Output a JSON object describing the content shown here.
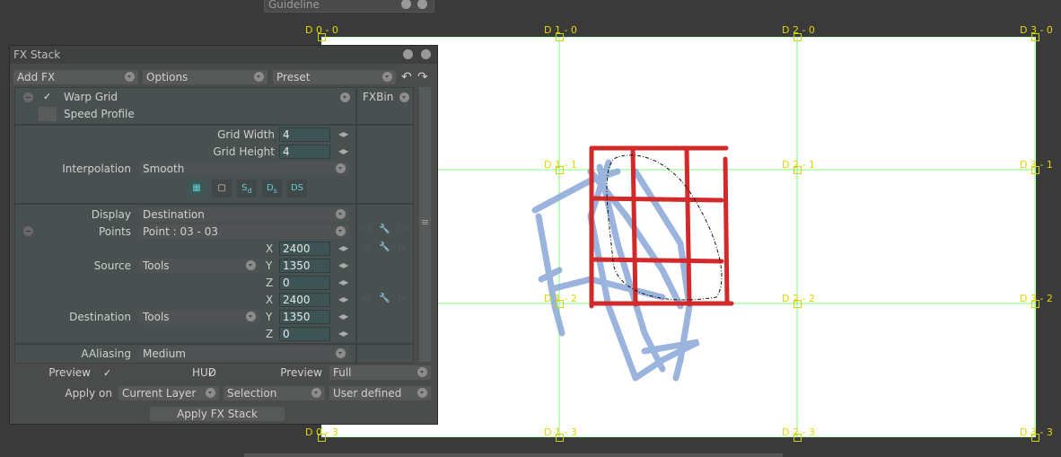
{
  "guideline_tab": {
    "title": "Guideline"
  },
  "canvas": {
    "grid_labels": {
      "row0": [
        "D 0 - 0",
        "D 1 - 0",
        "D 2 - 0",
        "D 3 - 0"
      ],
      "row1": [
        "D 1 - 1",
        "D 2 - 1",
        "D 3 - 1"
      ],
      "row2": [
        "D 1 - 2",
        "D 2 - 2",
        "D 3 - 2"
      ],
      "row3": [
        "D 0 - 3",
        "D 1 - 3",
        "D 2 - 3",
        "D 3 - 3"
      ]
    },
    "grid_color": "#7dff7d",
    "stroke_red": "#d22a2a",
    "stroke_blue": "#8aa8d8"
  },
  "panel": {
    "title": "FX Stack",
    "toolbar": {
      "add_fx": "Add FX",
      "options": "Options",
      "preset": "Preset"
    },
    "effect": {
      "name": "Warp Grid",
      "enabled": true,
      "speed_profile": "Speed Profile",
      "fxbin": "FXBin"
    },
    "grid_width": {
      "label": "Grid Width",
      "value": "4"
    },
    "grid_height": {
      "label": "Grid Height",
      "value": "4"
    },
    "interpolation": {
      "label": "Interpolation",
      "value": "Smooth"
    },
    "tool_icons": [
      "grid-icon",
      "frame-icon",
      "sd-icon",
      "ds-icon",
      "ds-swap-icon"
    ],
    "tool_icon_text": {
      "sd": "S",
      "sd_sub": "d",
      "ds": "D",
      "ds_sub": "s",
      "dsx": "DS"
    },
    "display": {
      "label": "Display",
      "value": "Destination"
    },
    "points": {
      "label": "Points",
      "value": "Point : 03 - 03"
    },
    "source": {
      "label": "Source",
      "mode": "Tools",
      "x": "2400",
      "y": "1350",
      "z": "0"
    },
    "destination": {
      "label": "Destination",
      "mode": "Tools",
      "x": "2400",
      "y": "1350",
      "z": "0"
    },
    "axis": {
      "x": "X",
      "y": "Y",
      "z": "Z"
    },
    "aaliasing": {
      "label": "AAliasing",
      "value": "Medium"
    },
    "preview": {
      "label": "Preview",
      "checked": true
    },
    "hud": {
      "label": "HUD",
      "checked": true
    },
    "preview_mode": {
      "label": "Preview",
      "value": "Full"
    },
    "apply_on": {
      "label": "Apply on",
      "layer": "Current Layer",
      "selection": "Selection",
      "user": "User defined"
    },
    "apply_button": "Apply FX Stack"
  }
}
